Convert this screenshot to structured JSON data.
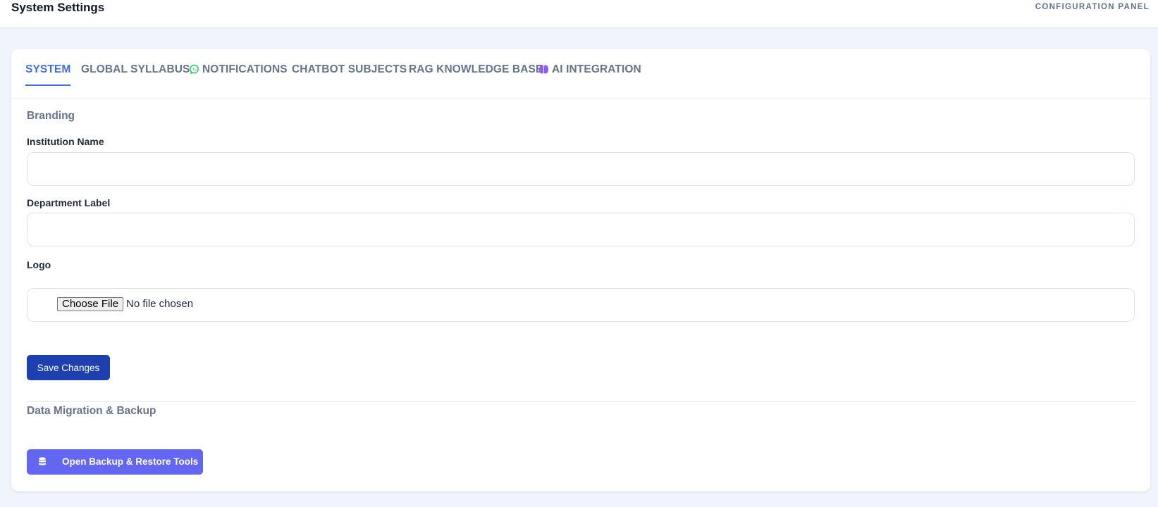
{
  "header": {
    "title": "System Settings",
    "panel_label": "CONFIGURATION PANEL"
  },
  "tabs": [
    {
      "label": "SYSTEM",
      "active": true,
      "icon": ""
    },
    {
      "label": "GLOBAL SYLLABUS",
      "active": false,
      "icon": ""
    },
    {
      "label": "NOTIFICATIONS",
      "active": false,
      "icon": "whatsapp-icon"
    },
    {
      "label": "CHATBOT SUBJECTS",
      "active": false,
      "icon": ""
    },
    {
      "label": "RAG KNOWLEDGE BASE",
      "active": false,
      "icon": ""
    },
    {
      "label": "AI INTEGRATION",
      "active": false,
      "icon": "brain-icon"
    }
  ],
  "branding": {
    "section_title": "Branding",
    "institution_label": "Institution Name",
    "institution_value": "",
    "department_label": "Department Label",
    "department_value": "",
    "logo_label": "Logo",
    "file_button_label": "Choose File",
    "file_status": "No file chosen",
    "save_label": "Save Changes"
  },
  "migration": {
    "section_title": "Data Migration & Backup",
    "backup_label": "Open Backup & Restore Tools",
    "backup_icon": "database-icon"
  },
  "colors": {
    "accent": "#3b6fe0",
    "save_button": "#1e40af",
    "backup_button": "#6366f1",
    "whatsapp": "#22c55e",
    "brain": "#8b5cf6"
  }
}
